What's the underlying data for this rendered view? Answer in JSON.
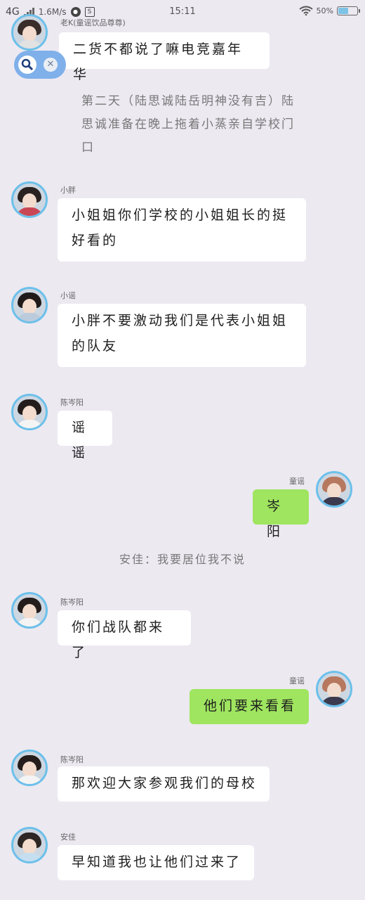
{
  "status_bar": {
    "network": "4G",
    "speed": "1.6M/s",
    "time": "15:11",
    "battery": "50%",
    "battery_level": 0.5
  },
  "narration": "第二天（陆思诚陆岳明神没有吉）陆思诚准备在晚上拖着小蒸亲自学校门口",
  "note": "安佳：我要居位我不说",
  "colors": {
    "bubble_mine": "#9fe55f",
    "bubble_other": "#ffffff",
    "avatar_ring": "#6cc0ea"
  },
  "messages": [
    {
      "name": "老K(童谣饮品尊尊)",
      "text": "二货不都说了嘛电竞嘉年华"
    },
    {
      "name": "小胖",
      "text": "小姐姐你们学校的小姐姐长的挺好看的"
    },
    {
      "name": "小谣",
      "text": "小胖不要激动我们是代表小姐姐的队友"
    },
    {
      "name": "陈岑阳",
      "text": "谣谣"
    },
    {
      "name": "童谣",
      "text": "岑阳"
    },
    {
      "name": "陈岑阳",
      "text": "你们战队都来了"
    },
    {
      "name": "童谣",
      "text": "他们要来看看"
    },
    {
      "name": "陈岑阳",
      "text": "那欢迎大家参观我们的母校"
    },
    {
      "name": "安佳",
      "text": "早知道我也让他们过来了"
    }
  ]
}
